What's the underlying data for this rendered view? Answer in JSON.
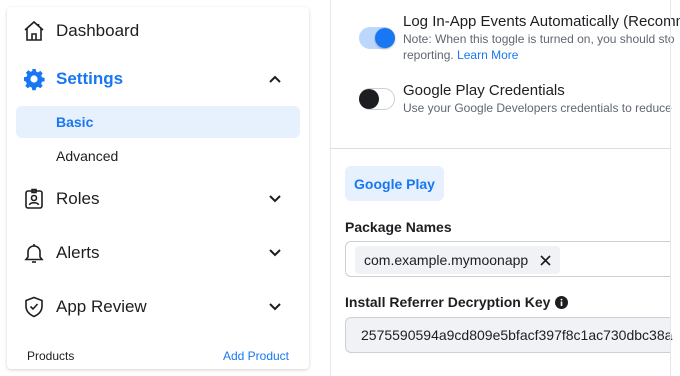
{
  "sidebar": {
    "items": [
      {
        "label": "Dashboard",
        "icon": "home-icon"
      },
      {
        "label": "Settings",
        "icon": "gear-icon",
        "expanded": true
      },
      {
        "label": "Roles",
        "icon": "id-badge-icon"
      },
      {
        "label": "Alerts",
        "icon": "bell-icon"
      },
      {
        "label": "App Review",
        "icon": "shield-check-icon"
      }
    ],
    "sub_items": [
      {
        "label": "Basic",
        "selected": true
      },
      {
        "label": "Advanced",
        "selected": false
      }
    ],
    "products_label": "Products",
    "add_product_label": "Add Product"
  },
  "main": {
    "log_events": {
      "title": "Log In-App Events Automatically (Recomme",
      "note_line1": "Note: When this toggle is turned on, you should sto",
      "note_line2": "reporting.",
      "learn_more": "Learn More",
      "enabled": true
    },
    "play_credentials": {
      "title": "Google Play Credentials",
      "note": "Use your Google Developers credentials to reduce",
      "enabled": false
    },
    "platform_tab": "Google Play",
    "package_names": {
      "label": "Package Names",
      "chips": [
        "com.example.mymoonapp"
      ]
    },
    "decryption_key": {
      "label": "Install Referrer Decryption Key",
      "value": "2575590594a9cd809e5bfacf397f8c1ac730dbc38a"
    }
  },
  "colors": {
    "accent": "#1877f2",
    "selected_bg": "#e7f0fd",
    "text": "#1c1e21",
    "muted": "#606770"
  }
}
